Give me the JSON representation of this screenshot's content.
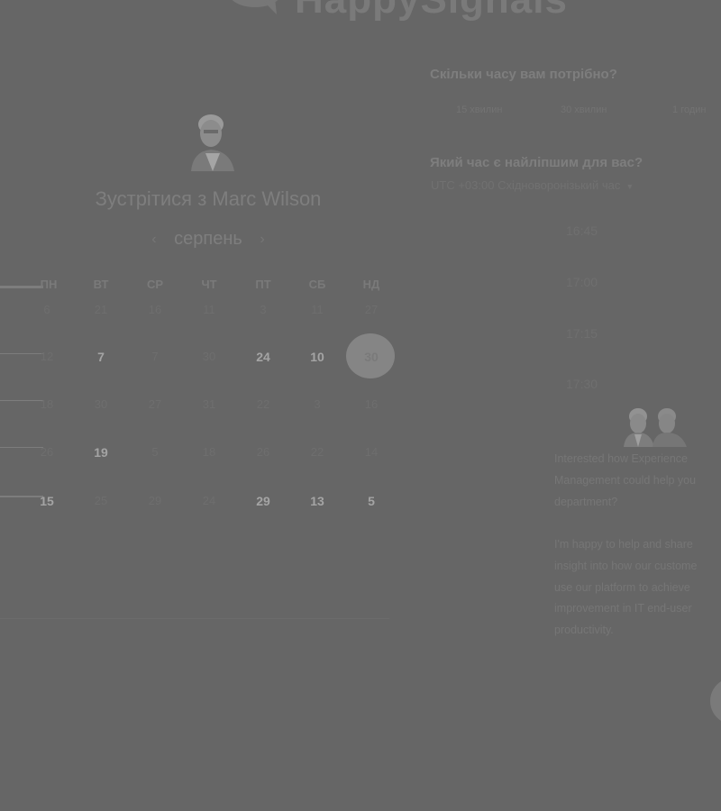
{
  "brand": {
    "logo_text": "HappySignals"
  },
  "left": {
    "title": "Зустрітися з Marc Wilson",
    "month": "серпень",
    "weekdays": [
      "ПН",
      "ВТ",
      "СР",
      "ЧТ",
      "ПТ",
      "СБ",
      "НД"
    ],
    "weeks": [
      [
        {
          "text": "6",
          "available": false
        },
        {
          "text": "21",
          "available": false
        },
        {
          "text": "16",
          "available": false
        },
        {
          "text": "11",
          "available": false
        },
        {
          "text": "3",
          "available": false
        },
        {
          "text": "11",
          "available": false
        },
        {
          "text": "27",
          "available": false
        }
      ],
      [
        {
          "text": "12",
          "available": false
        },
        {
          "text": "7",
          "available": true
        },
        {
          "text": "7",
          "available": false
        },
        {
          "text": "30",
          "available": false
        },
        {
          "text": "24",
          "available": true
        },
        {
          "text": "10",
          "available": true
        },
        {
          "text": "30",
          "available": true,
          "selected": true
        }
      ],
      [
        {
          "text": "18",
          "available": false
        },
        {
          "text": "30",
          "available": false
        },
        {
          "text": "27",
          "available": false
        },
        {
          "text": "31",
          "available": false
        },
        {
          "text": "22",
          "available": false
        },
        {
          "text": "3",
          "available": false
        },
        {
          "text": "16",
          "available": false
        }
      ],
      [
        {
          "text": "26",
          "available": false
        },
        {
          "text": "19",
          "available": true
        },
        {
          "text": "5",
          "available": false
        },
        {
          "text": "18",
          "available": false
        },
        {
          "text": "26",
          "available": false
        },
        {
          "text": "22",
          "available": false
        },
        {
          "text": "14",
          "available": false
        }
      ],
      [
        {
          "text": "15",
          "available": true
        },
        {
          "text": "25",
          "available": false
        },
        {
          "text": "29",
          "available": false
        },
        {
          "text": "24",
          "available": false
        },
        {
          "text": "29",
          "available": true
        },
        {
          "text": "13",
          "available": true
        },
        {
          "text": "5",
          "available": true
        }
      ]
    ]
  },
  "right": {
    "duration_question": "Скільки часу вам потрібно?",
    "durations": [
      "15 хвилин",
      "30 хвилин",
      "1 годин"
    ],
    "time_question": "Який час є найліпшим для вас?",
    "timezone": "UTC +03:00 Східноворонізький час",
    "slots": [
      "16:45",
      "17:00",
      "17:15",
      "17:30"
    ],
    "paragraph1": "Interested how Experience\nManagement could help you\ndepartment?",
    "paragraph2": "I'm happy to help and share\ninsight into how our custome\nuse our platform to achieve\nimprovement in IT end-user\nproductivity."
  },
  "colors": {
    "background": "#666666",
    "selected_day": "#858585"
  }
}
